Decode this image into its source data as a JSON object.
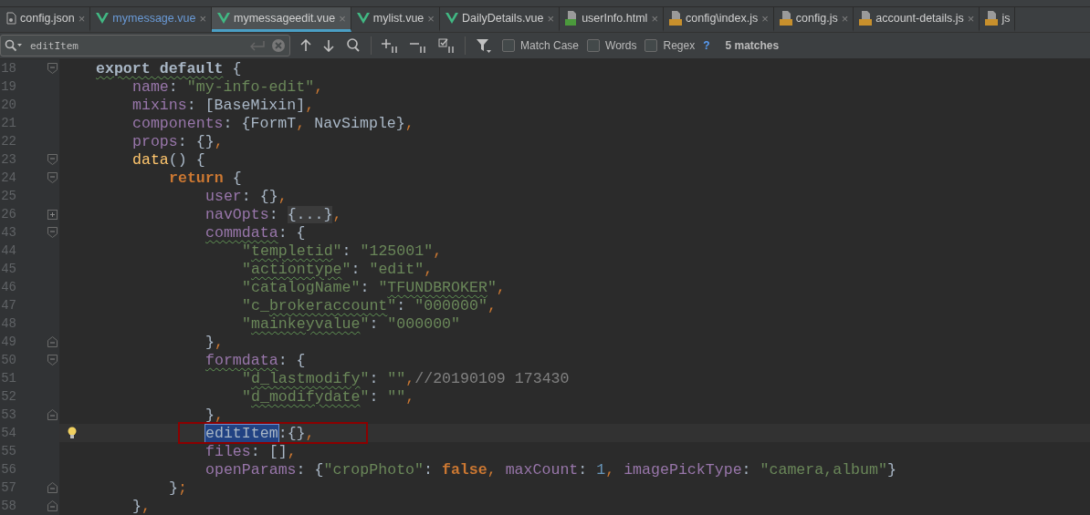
{
  "tabs": [
    {
      "label": "config.json",
      "kind": "json",
      "close": "×",
      "selected": false,
      "modified": false
    },
    {
      "label": "mymessage.vue",
      "kind": "vue",
      "close": "×",
      "selected": false,
      "modified": true
    },
    {
      "label": "mymessageedit.vue",
      "kind": "vue",
      "close": "×",
      "selected": true,
      "modified": false
    },
    {
      "label": "mylist.vue",
      "kind": "vue",
      "close": "×",
      "selected": false,
      "modified": false
    },
    {
      "label": "DailyDetails.vue",
      "kind": "vue",
      "close": "×",
      "selected": false,
      "modified": false
    },
    {
      "label": "userInfo.html",
      "kind": "html",
      "close": "×",
      "selected": false,
      "modified": false
    },
    {
      "label": "config\\index.js",
      "kind": "js",
      "close": "×",
      "selected": false,
      "modified": false
    },
    {
      "label": "config.js",
      "kind": "js",
      "close": "×",
      "selected": false,
      "modified": false
    },
    {
      "label": "account-details.js",
      "kind": "js",
      "close": "×",
      "selected": false,
      "modified": false
    },
    {
      "label": "js",
      "kind": "js",
      "selected": false,
      "modified": false
    }
  ],
  "search": {
    "value": "editItem",
    "options": [
      {
        "label": "Match Case",
        "checked": false
      },
      {
        "label": "Words",
        "checked": false
      },
      {
        "label": "Regex",
        "checked": false
      }
    ],
    "help": "?",
    "matches": "5 matches"
  },
  "lines": [
    {
      "number": "18",
      "kind": "fold-open",
      "tokens": [
        {
          "kind": "kw2",
          "text": "export default",
          "typo": true
        },
        {
          "kind": "plain",
          "text": " {"
        }
      ],
      "children": [
        {
          "number": "19",
          "tokens": [
            {
              "kind": "prop",
              "text": "name"
            },
            {
              "kind": "plain",
              "text": ": "
            },
            {
              "kind": "str",
              "text": "\"my-info-edit\""
            },
            {
              "kind": "punc",
              "text": ","
            }
          ]
        },
        {
          "number": "20",
          "tokens": [
            {
              "kind": "prop",
              "text": "mixins"
            },
            {
              "kind": "plain",
              "text": ": [BaseMixin]"
            },
            {
              "kind": "punc",
              "text": ","
            }
          ]
        },
        {
          "number": "21",
          "tokens": [
            {
              "kind": "prop",
              "text": "components"
            },
            {
              "kind": "plain",
              "text": ": {FormT"
            },
            {
              "kind": "punc",
              "text": ","
            },
            {
              "kind": "plain",
              "text": " NavSimple}"
            },
            {
              "kind": "punc",
              "text": ","
            }
          ]
        },
        {
          "number": "22",
          "tokens": [
            {
              "kind": "prop",
              "text": "props"
            },
            {
              "kind": "plain",
              "text": ": {}"
            },
            {
              "kind": "punc",
              "text": ","
            }
          ]
        },
        {
          "number": "23",
          "kind": "fold-open",
          "tokens": [
            {
              "kind": "fn",
              "text": "data"
            },
            {
              "kind": "plain",
              "text": "() {"
            }
          ],
          "children": [
            {
              "number": "24",
              "kind": "fold-open",
              "tokens": [
                {
                  "kind": "kw",
                  "text": "return"
                },
                {
                  "kind": "plain",
                  "text": " {"
                }
              ],
              "children": [
                {
                  "number": "25",
                  "tokens": [
                    {
                      "kind": "prop",
                      "text": "user"
                    },
                    {
                      "kind": "plain",
                      "text": ": {}"
                    },
                    {
                      "kind": "punc",
                      "text": ","
                    }
                  ]
                },
                {
                  "number": "26",
                  "kind": "collapsed",
                  "tokens": [
                    {
                      "kind": "prop",
                      "text": "navOpts"
                    },
                    {
                      "kind": "plain",
                      "text": ": "
                    },
                    {
                      "kind": "folded",
                      "text": "{...}"
                    },
                    {
                      "kind": "punc",
                      "text": ","
                    }
                  ]
                },
                {
                  "number": "43",
                  "kind": "fold-open",
                  "tokens": [
                    {
                      "kind": "prop",
                      "text": "commdata",
                      "typo": true
                    },
                    {
                      "kind": "plain",
                      "text": ": {"
                    }
                  ],
                  "children": [
                    {
                      "number": "44",
                      "tokens": [
                        {
                          "kind": "str",
                          "text": "\""
                        },
                        {
                          "kind": "str",
                          "text": "templetid",
                          "typo": true
                        },
                        {
                          "kind": "str",
                          "text": "\""
                        },
                        {
                          "kind": "plain",
                          "text": ": "
                        },
                        {
                          "kind": "str",
                          "text": "\"125001\""
                        },
                        {
                          "kind": "punc",
                          "text": ","
                        }
                      ]
                    },
                    {
                      "number": "45",
                      "tokens": [
                        {
                          "kind": "str",
                          "text": "\""
                        },
                        {
                          "kind": "str",
                          "text": "actiontype",
                          "typo": true
                        },
                        {
                          "kind": "str",
                          "text": "\""
                        },
                        {
                          "kind": "plain",
                          "text": ": "
                        },
                        {
                          "kind": "str",
                          "text": "\"edit\""
                        },
                        {
                          "kind": "punc",
                          "text": ","
                        }
                      ]
                    },
                    {
                      "number": "46",
                      "tokens": [
                        {
                          "kind": "str",
                          "text": "\"catalogName\""
                        },
                        {
                          "kind": "plain",
                          "text": ": "
                        },
                        {
                          "kind": "str",
                          "text": "\""
                        },
                        {
                          "kind": "str",
                          "text": "TFUNDBROKER",
                          "typo": true
                        },
                        {
                          "kind": "str",
                          "text": "\""
                        },
                        {
                          "kind": "punc",
                          "text": ","
                        }
                      ]
                    },
                    {
                      "number": "47",
                      "tokens": [
                        {
                          "kind": "str",
                          "text": "\"c_"
                        },
                        {
                          "kind": "str",
                          "text": "brokeraccount",
                          "typo": true
                        },
                        {
                          "kind": "str",
                          "text": "\""
                        },
                        {
                          "kind": "plain",
                          "text": ": "
                        },
                        {
                          "kind": "str",
                          "text": "\"000000\""
                        },
                        {
                          "kind": "punc",
                          "text": ","
                        }
                      ]
                    },
                    {
                      "number": "48",
                      "tokens": [
                        {
                          "kind": "str",
                          "text": "\""
                        },
                        {
                          "kind": "str",
                          "text": "mainkeyvalue",
                          "typo": true
                        },
                        {
                          "kind": "str",
                          "text": "\""
                        },
                        {
                          "kind": "plain",
                          "text": ": "
                        },
                        {
                          "kind": "str",
                          "text": "\"000000\""
                        }
                      ]
                    }
                  ]
                },
                {
                  "number": "49",
                  "kind": "fold-close",
                  "tokens": [
                    {
                      "kind": "plain",
                      "text": "}"
                    },
                    {
                      "kind": "punc",
                      "text": ","
                    }
                  ]
                },
                {
                  "number": "50",
                  "kind": "fold-open",
                  "tokens": [
                    {
                      "kind": "prop",
                      "text": "formdata",
                      "typo": true
                    },
                    {
                      "kind": "plain",
                      "text": ": {"
                    }
                  ],
                  "children": [
                    {
                      "number": "51",
                      "tokens": [
                        {
                          "kind": "str",
                          "text": "\""
                        },
                        {
                          "kind": "str",
                          "text": "d_lastmodify",
                          "typo": true
                        },
                        {
                          "kind": "str",
                          "text": "\""
                        },
                        {
                          "kind": "plain",
                          "text": ": "
                        },
                        {
                          "kind": "str",
                          "text": "\"\""
                        },
                        {
                          "kind": "punc",
                          "text": ","
                        },
                        {
                          "kind": "comment",
                          "text": "//20190109 173430"
                        }
                      ]
                    },
                    {
                      "number": "52",
                      "tokens": [
                        {
                          "kind": "str",
                          "text": "\""
                        },
                        {
                          "kind": "str",
                          "text": "d_modifydate",
                          "typo": true
                        },
                        {
                          "kind": "str",
                          "text": "\""
                        },
                        {
                          "kind": "plain",
                          "text": ": "
                        },
                        {
                          "kind": "str",
                          "text": "\"\""
                        },
                        {
                          "kind": "punc",
                          "text": ","
                        }
                      ]
                    }
                  ]
                },
                {
                  "number": "53",
                  "kind": "fold-close",
                  "tokens": [
                    {
                      "kind": "plain",
                      "text": "}"
                    },
                    {
                      "kind": "punc",
                      "text": ","
                    }
                  ]
                },
                {
                  "number": "54",
                  "current": true,
                  "bulb": true,
                  "annotated": true,
                  "tokens": [
                    {
                      "kind": "match",
                      "text": "editItem"
                    },
                    {
                      "kind": "plain",
                      "text": ":{}"
                    },
                    {
                      "kind": "punc",
                      "text": ","
                    }
                  ]
                },
                {
                  "number": "55",
                  "tokens": [
                    {
                      "kind": "prop",
                      "text": "files"
                    },
                    {
                      "kind": "plain",
                      "text": ": []"
                    },
                    {
                      "kind": "punc",
                      "text": ","
                    }
                  ]
                },
                {
                  "number": "56",
                  "tokens": [
                    {
                      "kind": "prop",
                      "text": "openParams"
                    },
                    {
                      "kind": "plain",
                      "text": ": {"
                    },
                    {
                      "kind": "str",
                      "text": "\"cropPhoto\""
                    },
                    {
                      "kind": "plain",
                      "text": ": "
                    },
                    {
                      "kind": "kw",
                      "text": "false"
                    },
                    {
                      "kind": "punc",
                      "text": ", "
                    },
                    {
                      "kind": "prop",
                      "text": "maxCount"
                    },
                    {
                      "kind": "plain",
                      "text": ": "
                    },
                    {
                      "kind": "num",
                      "text": "1"
                    },
                    {
                      "kind": "punc",
                      "text": ", "
                    },
                    {
                      "kind": "prop",
                      "text": "imagePickType"
                    },
                    {
                      "kind": "plain",
                      "text": ": "
                    },
                    {
                      "kind": "str",
                      "text": "\"camera,album\""
                    },
                    {
                      "kind": "plain",
                      "text": "}"
                    }
                  ]
                }
              ]
            },
            {
              "number": "57",
              "kind": "fold-close",
              "tokens": [
                {
                  "kind": "plain",
                  "text": "}"
                },
                {
                  "kind": "punc",
                  "text": ";"
                }
              ]
            }
          ]
        },
        {
          "number": "58",
          "kind": "fold-close",
          "tokens": [
            {
              "kind": "plain",
              "text": "}"
            },
            {
              "kind": "punc",
              "text": ","
            }
          ]
        }
      ]
    }
  ]
}
